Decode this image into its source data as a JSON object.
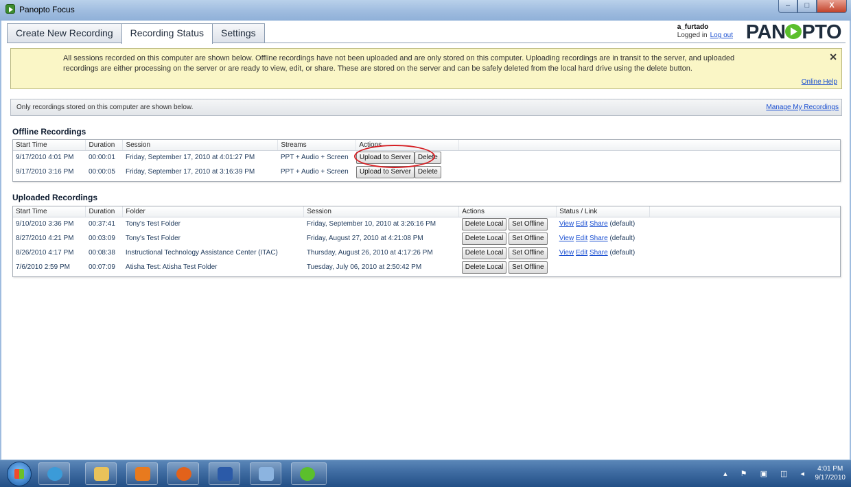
{
  "window": {
    "title": "Panopto Focus",
    "minimize": "–",
    "maximize": "□",
    "close": "X"
  },
  "tabs": [
    {
      "label": "Create New Recording"
    },
    {
      "label": "Recording Status"
    },
    {
      "label": "Settings"
    }
  ],
  "user": {
    "name": "a_furtado",
    "status": "Logged in",
    "logout": "Log out"
  },
  "logo": {
    "prefix": "PAN",
    "suffix": "PTO"
  },
  "info": {
    "text": "All sessions recorded on this computer are shown below.  Offline recordings have not been uploaded and are only stored on this computer.  Uploading recordings are in transit to the server, and uploaded recordings are either processing on the server or are ready to view, edit, or share.  These are stored on the server and can be safely deleted from the local hard drive using the delete button.",
    "close": "✕",
    "help": "Online Help"
  },
  "storebar": {
    "text": "Only recordings stored on this computer are shown below.",
    "link": "Manage My Recordings"
  },
  "offline": {
    "title": "Offline Recordings",
    "headers": {
      "start": "Start Time",
      "duration": "Duration",
      "session": "Session",
      "streams": "Streams",
      "actions": "Actions"
    },
    "rows": [
      {
        "start": "9/17/2010 4:01 PM",
        "duration": "00:00:01",
        "session": "Friday, September 17, 2010 at 4:01:27 PM",
        "streams": "PPT + Audio + Screen",
        "upload": "Upload to Server",
        "delete": "Delete"
      },
      {
        "start": "9/17/2010 3:16 PM",
        "duration": "00:00:05",
        "session": "Friday, September 17, 2010 at 3:16:39 PM",
        "streams": "PPT + Audio + Screen",
        "upload": "Upload to Server",
        "delete": "Delete"
      }
    ]
  },
  "uploaded": {
    "title": "Uploaded Recordings",
    "headers": {
      "start": "Start Time",
      "duration": "Duration",
      "folder": "Folder",
      "session": "Session",
      "actions": "Actions",
      "status": "Status / Link"
    },
    "rows": [
      {
        "start": "9/10/2010 3:36 PM",
        "duration": "00:37:41",
        "folder": "Tony's Test Folder",
        "session": "Friday, September 10, 2010 at 3:26:16 PM",
        "delete_local": "Delete Local",
        "set_offline": "Set Offline",
        "view": "View",
        "edit": "Edit",
        "share": "Share",
        "note": "(default)"
      },
      {
        "start": "8/27/2010 4:21 PM",
        "duration": "00:03:09",
        "folder": "Tony's Test Folder",
        "session": "Friday, August 27, 2010 at 4:21:08 PM",
        "delete_local": "Delete Local",
        "set_offline": "Set Offline",
        "view": "View",
        "edit": "Edit",
        "share": "Share",
        "note": "(default)"
      },
      {
        "start": "8/26/2010 4:17 PM",
        "duration": "00:08:38",
        "folder": "Instructional Technology Assistance Center (ITAC)",
        "session": "Thursday, August 26, 2010 at 4:17:26 PM",
        "delete_local": "Delete Local",
        "set_offline": "Set Offline",
        "view": "View",
        "edit": "Edit",
        "share": "Share",
        "note": "(default)"
      },
      {
        "start": "7/6/2010 2:59 PM",
        "duration": "00:07:09",
        "folder": "Atisha Test: Atisha Test Folder",
        "session": "Tuesday, July 06, 2010 at 2:50:42 PM",
        "delete_local": "Delete Local",
        "set_offline": "Set Offline"
      }
    ]
  },
  "taskbar": {
    "items": [
      {
        "name": "internet-explorer-icon",
        "color": "#3b9bd8"
      },
      {
        "name": "file-explorer-icon",
        "color": "#e9c25a"
      },
      {
        "name": "media-player-icon",
        "color": "#e87a1e"
      },
      {
        "name": "firefox-icon",
        "color": "#e2621b"
      },
      {
        "name": "word-icon",
        "color": "#2b5aa8"
      },
      {
        "name": "paint-icon",
        "color": "#8cb4e0"
      },
      {
        "name": "panopto-focus-icon",
        "color": "#5bbf2c"
      }
    ],
    "tray": "▴ ⚑ ▣ ◫ ◂",
    "time": "4:01 PM",
    "date": "9/17/2010"
  }
}
